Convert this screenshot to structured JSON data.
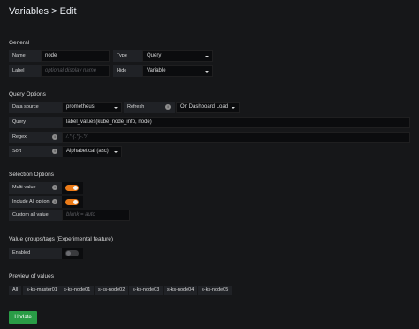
{
  "header": {
    "title": "Variables > Edit"
  },
  "general": {
    "section_title": "General",
    "name_label": "Name",
    "name_value": "node",
    "type_label": "Type",
    "type_value": "Query",
    "label_label": "Label",
    "label_placeholder": "optional display name",
    "hide_label": "Hide",
    "hide_value": "Variable"
  },
  "query_options": {
    "section_title": "Query Options",
    "data_source_label": "Data source",
    "data_source_value": "prometheus",
    "refresh_label": "Refresh",
    "refresh_value": "On Dashboard Load",
    "query_label": "Query",
    "query_value": "label_values(kube_node_info, node)",
    "regex_label": "Regex",
    "regex_placeholder": "/.*-(.*)-.*/",
    "sort_label": "Sort",
    "sort_value": "Alphabetical (asc)"
  },
  "selection_options": {
    "section_title": "Selection Options",
    "multi_value_label": "Multi-value",
    "multi_value_on": true,
    "include_all_label": "Include All option",
    "include_all_on": true,
    "custom_all_label": "Custom all value",
    "custom_all_placeholder": "blank = auto"
  },
  "value_groups": {
    "section_title": "Value groups/tags (Experimental feature)",
    "enabled_label": "Enabled",
    "enabled_on": false
  },
  "preview": {
    "section_title": "Preview of values",
    "values": [
      "All",
      "s-ks-master01",
      "s-ks-node01",
      "s-ks-node02",
      "s-ks-node03",
      "s-ks-node04",
      "s-ks-node05"
    ]
  },
  "actions": {
    "update_label": "Update"
  },
  "colors": {
    "accent": "#eb7b18",
    "update_button": "#299c46",
    "background": "#161719"
  }
}
